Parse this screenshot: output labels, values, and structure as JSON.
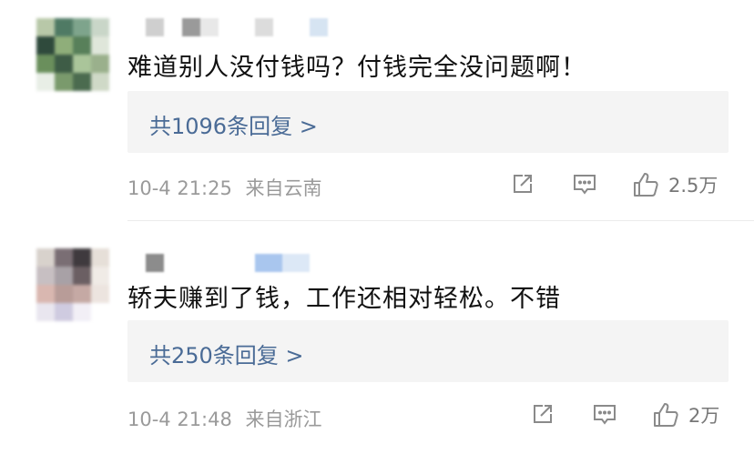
{
  "comments": [
    {
      "text": "难道别人没付钱吗？付钱完全没问题啊！",
      "reply_link": "共1096条回复 >",
      "time": "10-4 21:25",
      "location": "来自云南",
      "likes": "2.5万",
      "avatar_colors": [
        "#b8c8a8",
        "#4f7a64",
        "#7ea48c",
        "#c9d6c8",
        "#2f4a3c",
        "#8fae7a",
        "#58805a",
        "#dfe6da",
        "#6a8f5c",
        "#3e5c46",
        "#aac59a",
        "#9ab08c",
        "#e8eee6",
        "#7a9a6c",
        "#4b6b4f",
        "#cfd9c7"
      ]
    },
    {
      "text": "轿夫赚到了钱，工作还相对轻松。不错",
      "reply_link": "共250条回复 >",
      "time": "10-4 21:48",
      "location": "来自浙江",
      "likes": "2万",
      "avatar_colors": [
        "#d8d2cc",
        "#7a6e74",
        "#3f3a3e",
        "#e6dfd8",
        "#c7bfc2",
        "#a8a1a6",
        "#6b5f63",
        "#f0ebe6",
        "#d9b7b0",
        "#b89c98",
        "#c5a9a4",
        "#ece4df",
        "#e9e6ef",
        "#cfcbe0",
        "#f2eff6",
        "#ffffff"
      ]
    }
  ],
  "icons": {
    "share": "share-icon",
    "comment": "comment-icon",
    "like": "thumbs-up-icon"
  }
}
